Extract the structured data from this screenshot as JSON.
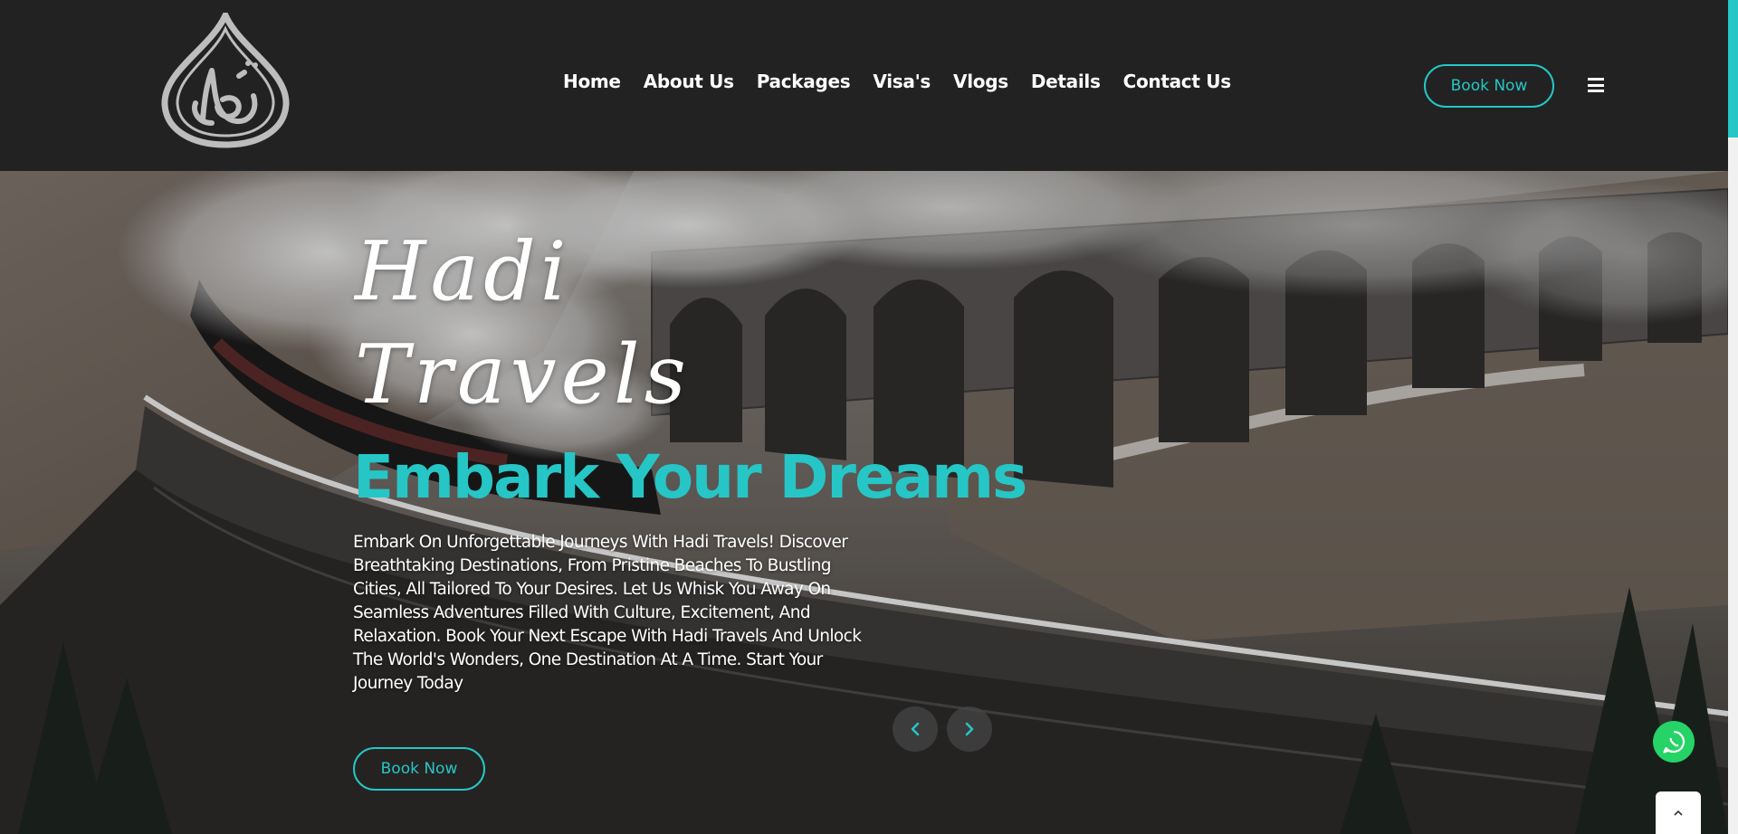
{
  "header": {
    "logo_alt": "Hadi Travels logo",
    "nav": [
      "Home",
      "About Us",
      "Packages",
      "Visa's",
      "Vlogs",
      "Details",
      "Contact Us"
    ],
    "book_now_label": "Book Now",
    "menu_icon": "hamburger-icon"
  },
  "hero": {
    "script_title_line1": "Hadi",
    "script_title_line2": "Travels",
    "headline": "Embark Your Dreams",
    "description": "Embark On Unforgettable Journeys With Hadi Travels! Discover Breathtaking Destinations, From Pristine Beaches To Bustling Cities, All Tailored To Your Desires. Let Us Whisk You Away On Seamless Adventures Filled With Culture, Excitement, And Relaxation. Book Your Next Escape With Hadi Travels And Unlock The World's Wonders, One Destination At A Time. Start Your Journey Today",
    "book_now_label": "Book Now",
    "background_image": "steam train crossing stone viaduct in winter",
    "prev_icon": "chevron-left-icon",
    "next_icon": "chevron-right-icon"
  },
  "floating": {
    "whatsapp_icon": "whatsapp-icon",
    "back_to_top_icon": "chevron-up-icon"
  },
  "colors": {
    "accent": "#26c6c6",
    "header_bg": "#222222",
    "whatsapp": "#25d366"
  }
}
